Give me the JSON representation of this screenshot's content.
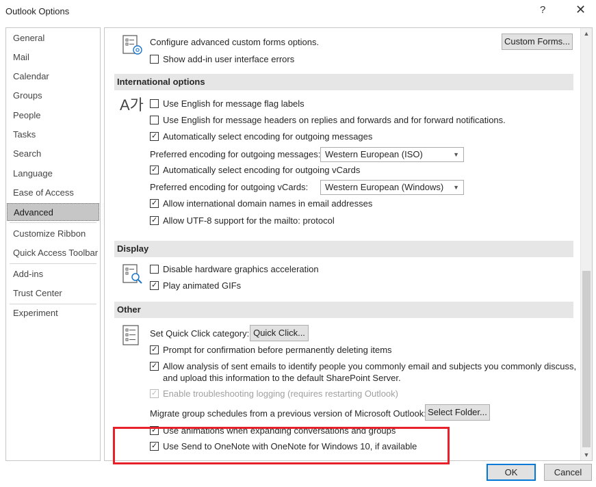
{
  "window": {
    "title": "Outlook Options",
    "help": "?",
    "close": "✕"
  },
  "nav": {
    "items": [
      {
        "label": "General"
      },
      {
        "label": "Mail"
      },
      {
        "label": "Calendar"
      },
      {
        "label": "Groups"
      },
      {
        "label": "People"
      },
      {
        "label": "Tasks"
      },
      {
        "label": "Search"
      },
      {
        "label": "Language"
      },
      {
        "label": "Ease of Access"
      },
      {
        "label": "Advanced"
      },
      {
        "label": "Customize Ribbon"
      },
      {
        "label": "Quick Access Toolbar"
      },
      {
        "label": "Add-ins"
      },
      {
        "label": "Trust Center"
      },
      {
        "label": "Experiment"
      }
    ],
    "selected": "Advanced"
  },
  "custom_forms": {
    "text": "Configure advanced custom forms options.",
    "button": "Custom Forms...",
    "show_addin_errors": {
      "label": "Show add-in user interface errors",
      "checked": false
    }
  },
  "international": {
    "header": "International options",
    "icon_text": "A가",
    "flag_labels": {
      "label": "Use English for message flag labels",
      "checked": false
    },
    "msg_headers": {
      "label": "Use English for message headers on replies and forwards and for forward notifications.",
      "checked": false
    },
    "auto_encoding": {
      "label": "Automatically select encoding for outgoing messages",
      "checked": true
    },
    "pref_encoding_label": "Preferred encoding for outgoing messages:",
    "pref_encoding_value": "Western European (ISO)",
    "auto_vcard": {
      "label": "Automatically select encoding for outgoing vCards",
      "checked": true
    },
    "pref_vcard_label": "Preferred encoding for outgoing vCards:",
    "pref_vcard_value": "Western European (Windows)",
    "idn": {
      "label": "Allow international domain names in email addresses",
      "checked": true
    },
    "utf8": {
      "label": "Allow UTF-8 support for the mailto: protocol",
      "checked": true
    }
  },
  "display": {
    "header": "Display",
    "hw_accel": {
      "label": "Disable hardware graphics acceleration",
      "checked": false
    },
    "gifs": {
      "label": "Play animated GIFs",
      "checked": true
    }
  },
  "other": {
    "header": "Other",
    "quick_click_label": "Set Quick Click category:",
    "quick_click_button": "Quick Click...",
    "prompt_delete": {
      "label": "Prompt for confirmation before permanently deleting items",
      "checked": true
    },
    "analysis_line1": "Allow analysis of sent emails to identify people you commonly email and subjects you commonly discuss,",
    "analysis_line2": "and upload this information to the default SharePoint Server.",
    "analysis_checked": true,
    "troubleshooting": {
      "label": "Enable troubleshooting logging (requires restarting Outlook)",
      "checked": true,
      "disabled": true
    },
    "migrate_label": "Migrate group schedules from a previous version of Microsoft Outlook:",
    "migrate_button": "Select Folder...",
    "animations": {
      "label": "Use animations when expanding conversations and groups",
      "checked": true
    },
    "onenote": {
      "label": "Use Send to OneNote with OneNote for Windows 10, if available",
      "checked": true
    }
  },
  "footer": {
    "ok": "OK",
    "cancel": "Cancel"
  },
  "colors": {
    "accent": "#0078d7",
    "highlight": "#e8202a",
    "section_bg": "#e6e6e6"
  }
}
